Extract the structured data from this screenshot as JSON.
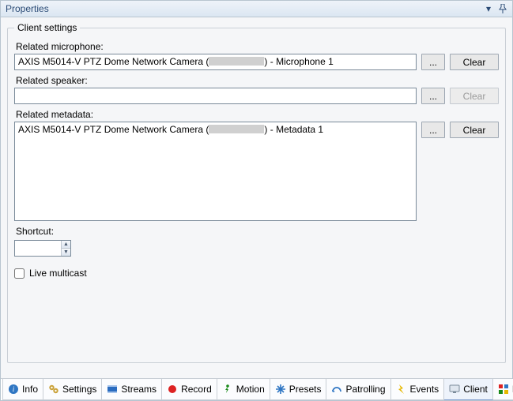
{
  "panel": {
    "title": "Properties"
  },
  "client": {
    "legend": "Client settings",
    "mic_label": "Related microphone:",
    "mic_value_pre": "AXIS M5014-V PTZ Dome Network Camera (",
    "mic_value_post": ") - Microphone 1",
    "speaker_label": "Related speaker:",
    "speaker_value": "",
    "meta_label": "Related metadata:",
    "meta_item_pre": "AXIS M5014-V PTZ Dome Network Camera (",
    "meta_item_post": ") - Metadata 1",
    "shortcut_label": "Shortcut:",
    "shortcut_value": "",
    "live_multicast_label": "Live multicast",
    "browse_label": "...",
    "clear_label": "Clear"
  },
  "tabs": {
    "info": "Info",
    "settings": "Settings",
    "streams": "Streams",
    "record": "Record",
    "motion": "Motion",
    "presets": "Presets",
    "patrolling": "Patrolling",
    "events": "Events",
    "client": "Client",
    "priv": "Priv"
  }
}
